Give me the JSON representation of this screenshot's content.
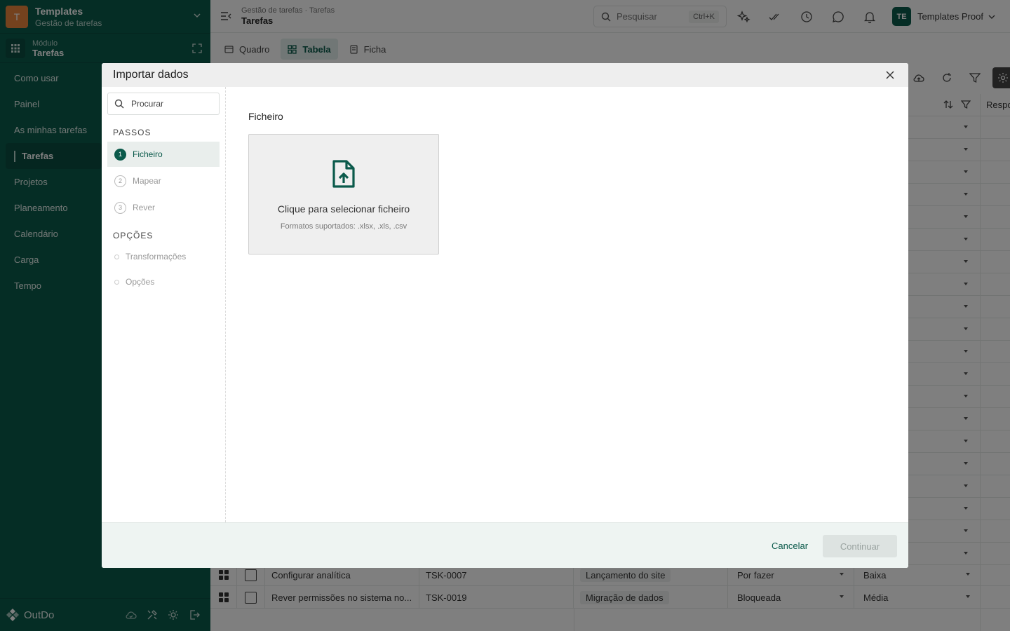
{
  "workspace": {
    "badge": "T",
    "title": "Templates",
    "subtitle": "Gestão de tarefas"
  },
  "module": {
    "label": "Módulo",
    "name": "Tarefas"
  },
  "nav": [
    "Como usar",
    "Painel",
    "As minhas tarefas",
    "Tarefas",
    "Projetos",
    "Planeamento",
    "Calendário",
    "Carga",
    "Tempo"
  ],
  "nav_active": "Tarefas",
  "footer": {
    "brand": "OutDo"
  },
  "topbar": {
    "breadcrumb": "Gestão de tarefas · Tarefas",
    "title": "Tarefas",
    "search_placeholder": "Pesquisar",
    "search_shortcut": "Ctrl+K",
    "user_initials": "TE",
    "user_name": "Templates Proof"
  },
  "view_tabs": [
    "Quadro",
    "Tabela",
    "Ficha"
  ],
  "view_tab_active": "Tabela",
  "table": {
    "header_right": "Respo",
    "rows": [
      {
        "title": "Configurar analítica",
        "id": "TSK-0007",
        "project": "Lançamento do site",
        "status": "Por fazer",
        "priority": "Baixa"
      },
      {
        "title": "Rever permissões no sistema no...",
        "id": "TSK-0019",
        "project": "Migração de dados",
        "status": "Bloqueada",
        "priority": "Média"
      }
    ]
  },
  "modal": {
    "title": "Importar dados",
    "search_placeholder": "Procurar",
    "steps_heading": "PASSOS",
    "steps": [
      {
        "num": "1",
        "label": "Ficheiro"
      },
      {
        "num": "2",
        "label": "Mapear"
      },
      {
        "num": "3",
        "label": "Rever"
      }
    ],
    "options_heading": "OPÇÕES",
    "options": [
      "Transformações",
      "Opções"
    ],
    "file_label": "Ficheiro",
    "drop_title": "Clique para selecionar ficheiro",
    "drop_formats": "Formatos suportados: .xlsx, .xls, .csv",
    "cancel": "Cancelar",
    "continue": "Continuar"
  },
  "colors": {
    "primary": "#0b5a4b",
    "accent": "#e8853d"
  }
}
